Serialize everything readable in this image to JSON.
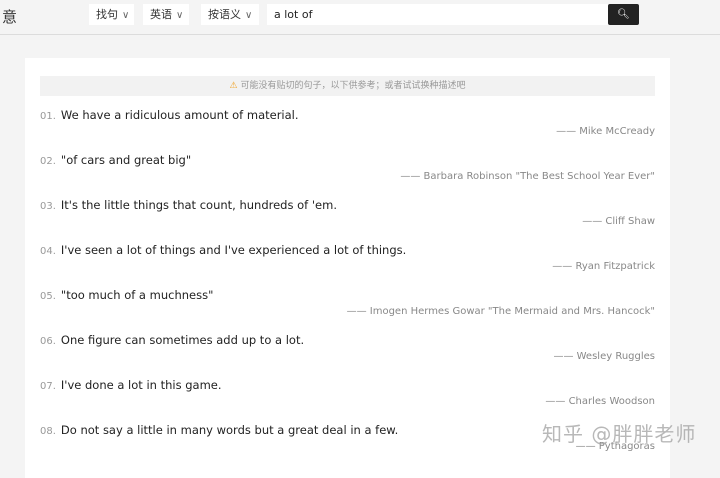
{
  "header": {
    "logo": "意",
    "filters": [
      {
        "label": "找句"
      },
      {
        "label": "英语"
      },
      {
        "label": "按语义"
      }
    ],
    "search_value": "a lot of",
    "search_icon": "search-icon"
  },
  "notice": {
    "icon": "warning-icon",
    "text": "可能没有贴切的句子，以下供参考；或者试试换种描述吧"
  },
  "results": [
    {
      "num": "01.",
      "text": "We have a ridiculous amount of material.",
      "author": "—— Mike McCready"
    },
    {
      "num": "02.",
      "text": "\"of cars and great big\"",
      "author": "—— Barbara Robinson  \"The Best School Year Ever\""
    },
    {
      "num": "03.",
      "text": "It's the little things that count, hundreds of 'em.",
      "author": "—— Cliff Shaw"
    },
    {
      "num": "04.",
      "text": "I've seen a lot of things and I've experienced a lot of things.",
      "author": "—— Ryan Fitzpatrick"
    },
    {
      "num": "05.",
      "text": "\"too much of a muchness\"",
      "author": "—— Imogen Hermes Gowar  \"The Mermaid and Mrs. Hancock\""
    },
    {
      "num": "06.",
      "text": "One figure can sometimes add up to a lot.",
      "author": "—— Wesley Ruggles"
    },
    {
      "num": "07.",
      "text": "I've done a lot in this game.",
      "author": "—— Charles Woodson"
    },
    {
      "num": "08.",
      "text": "Do not say a little in many words but a great deal in a few.",
      "author": "—— Pythagoras"
    }
  ],
  "watermark": "知乎 @胖胖老师"
}
